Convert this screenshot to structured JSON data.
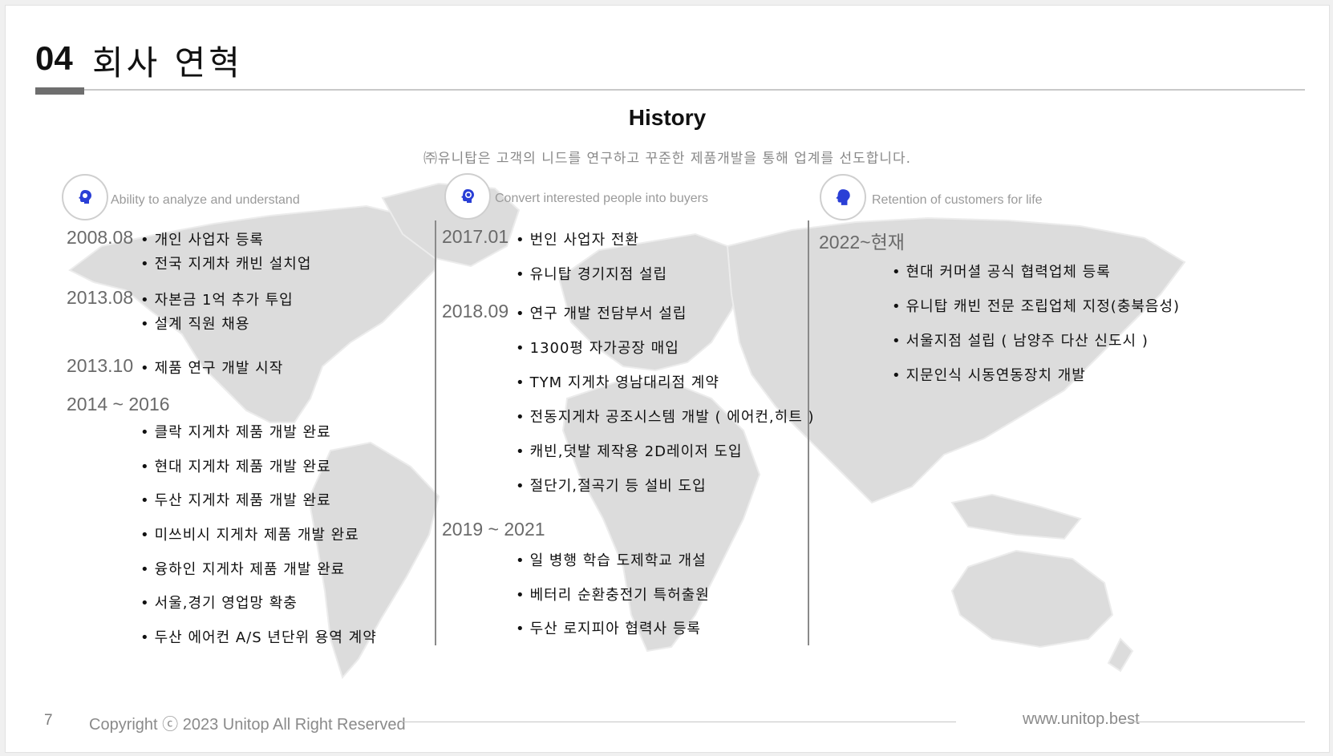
{
  "header": {
    "number": "04",
    "title": "회사 연혁"
  },
  "section": {
    "heading": "History",
    "subtitle": "㈜유니탑은 고객의 니드를 연구하고 꾸준한 제품개발을 통해 업계를 선도합니다."
  },
  "columns": [
    {
      "icon": "brain-icon",
      "heading": "Ability to analyze and understand"
    },
    {
      "icon": "brain-gear-icon",
      "heading": "Convert interested people into buyers"
    },
    {
      "icon": "head-icon",
      "heading": "Retention of customers for life"
    }
  ],
  "timeline": {
    "col1": {
      "y2008_08": {
        "year": "2008.08",
        "items": [
          "개인 사업자 등록",
          "전국 지게차 캐빈 설치업"
        ]
      },
      "y2013_08": {
        "year": "2013.08",
        "items": [
          "자본금 1억 추가 투입",
          "설계 직원 채용"
        ]
      },
      "y2013_10": {
        "year": "2013.10",
        "items": [
          "제품 연구 개발 시작"
        ]
      },
      "y2014_2016": {
        "year": "2014 ~ 2016",
        "items": [
          "클락 지게차 제품 개발 완료",
          "현대 지게차 제품 개발 완료",
          "두산 지게차 제품 개발 완료",
          "미쓰비시 지게차 제품 개발 완료",
          "융하인 지게차 제품 개발 완료",
          "서울,경기 영업망 확충",
          "두산 에어컨 A/S 년단위 용역 계약"
        ]
      }
    },
    "col2": {
      "y2017_01": {
        "year": "2017.01",
        "items": [
          "번인 사업자 전환",
          "유니탑 경기지점 설립"
        ]
      },
      "y2018_09": {
        "year": "2018.09",
        "items": [
          "연구 개발 전담부서 설립",
          "1300평 자가공장 매입",
          "TYM 지게차 영남대리점 계약",
          "전동지게차 공조시스템 개발 ( 에어컨,히트 )",
          "캐빈,덧발 제작용 2D레이저 도입",
          "절단기,절곡기 등 설비 도입"
        ]
      },
      "y2019_2021": {
        "year": "2019 ~ 2021",
        "items": [
          "일 병행 학습 도제학교 개설",
          "베터리 순환충전기 특허출원",
          "두산 로지피아 협력사 등록"
        ]
      }
    },
    "col3": {
      "y2022": {
        "year": "2022~현재",
        "items": [
          "현대 커머셜 공식 협력업체 등록",
          "유니탑 캐빈 전문 조립업체 지정(충북음성)",
          "서울지점 설립 ( 남양주 다산 신도시 )",
          "지문인식 시동연동장치 개발"
        ]
      }
    }
  },
  "footer": {
    "page": "7",
    "copyright": "Copyright ⓒ 2023 Unitop All Right Reserved",
    "website": "www.unitop.best"
  },
  "colors": {
    "icon": "#2a3fd6",
    "map": "#dcdcdc",
    "accent_bar": "#6e6e6e"
  }
}
